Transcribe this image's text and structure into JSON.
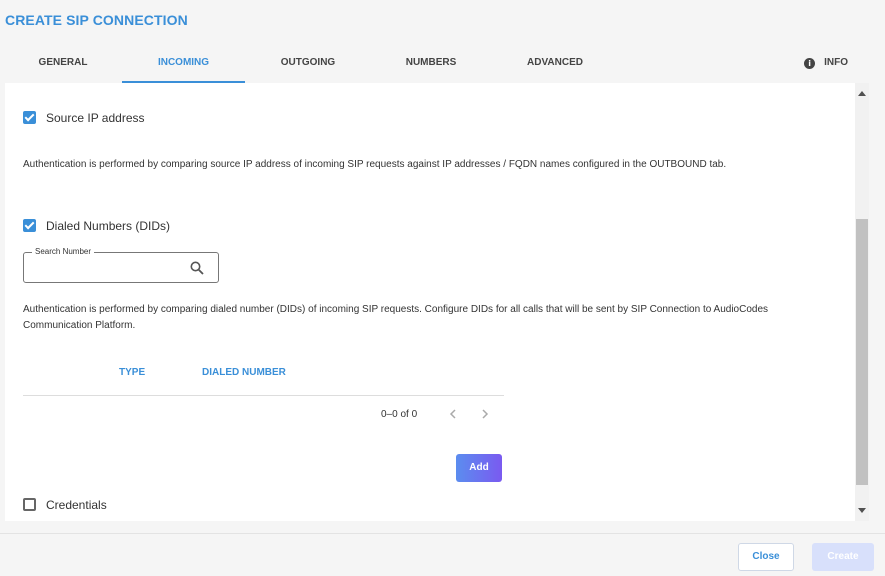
{
  "dialog": {
    "title": "CREATE SIP CONNECTION"
  },
  "tabs": [
    {
      "label": "GENERAL"
    },
    {
      "label": "INCOMING",
      "active": true
    },
    {
      "label": "OUTGOING"
    },
    {
      "label": "NUMBERS"
    },
    {
      "label": "ADVANCED"
    }
  ],
  "info_tab": {
    "label": "INFO",
    "icon": "info-icon"
  },
  "source_ip": {
    "label": "Source IP address",
    "checked": true,
    "description": "Authentication is performed by comparing source IP address of incoming SIP requests against IP addresses / FQDN names configured in the OUTBOUND tab."
  },
  "dialed_numbers": {
    "label": "Dialed Numbers (DIDs)",
    "checked": true,
    "search": {
      "legend": "Search Number",
      "value": "",
      "icon": "search-icon"
    },
    "description_line1": "Authentication is performed by comparing dialed number (DIDs) of incoming SIP requests. Configure DIDs for all calls that will be sent by SIP Connection to AudioCodes",
    "description_line2": "Communication Platform.",
    "table": {
      "columns": [
        "TYPE",
        "DIALED NUMBER"
      ],
      "rows": [],
      "pagination": "0–0 of 0"
    },
    "add_label": "Add"
  },
  "credentials": {
    "label": "Credentials",
    "checked": false
  },
  "footer": {
    "close_label": "Close",
    "create_label": "Create"
  },
  "colors": {
    "accent": "#3a8fd8",
    "add_gradient_start": "#5b8def",
    "add_gradient_end": "#7a5af0",
    "create_disabled": "#d8e0fb"
  }
}
